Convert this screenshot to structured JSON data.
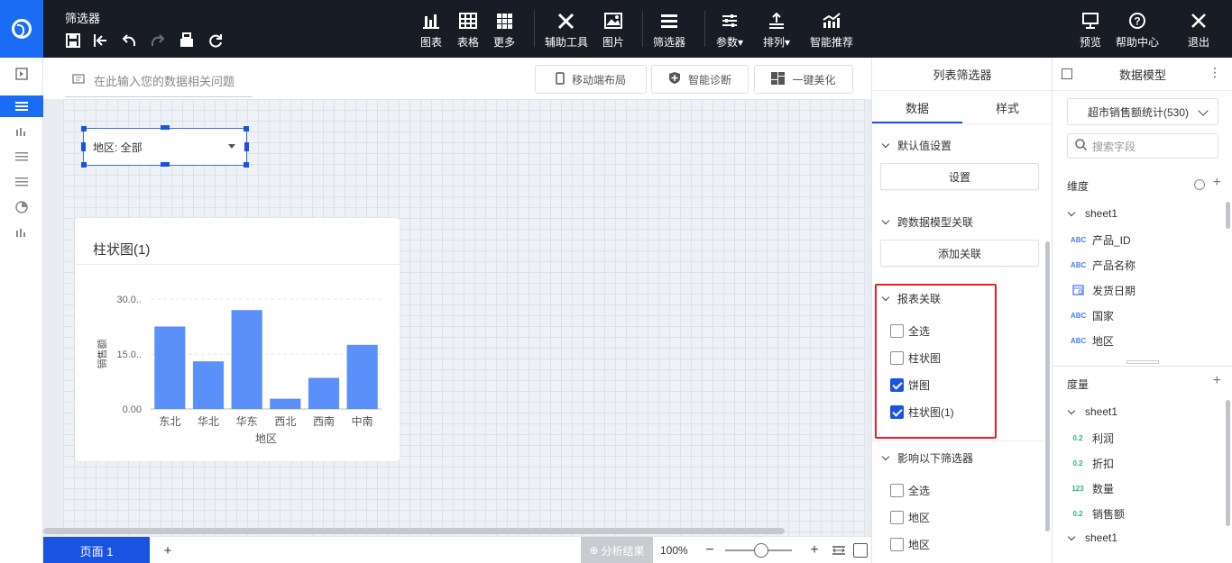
{
  "app": {
    "title": "筛选器"
  },
  "toolbar": {
    "chart": "图表",
    "table": "表格",
    "more": "更多",
    "assist": "辅助工具",
    "image": "图片",
    "filter": "筛选器",
    "param": "参数",
    "arrange": "排列",
    "smart": "智能推荐",
    "preview": "预览",
    "help": "帮助中心",
    "exit": "退出"
  },
  "canvas": {
    "question_placeholder": "在此输入您的数据相关问题",
    "mobile_layout": "移动端布局",
    "smart_diagnose": "智能诊断",
    "beautify": "一键美化",
    "filter_widget": "地区: 全部"
  },
  "chart_data": {
    "type": "bar",
    "title": "柱状图(1)",
    "categories": [
      "东北",
      "华北",
      "华东",
      "西北",
      "西南",
      "中南"
    ],
    "values": [
      22.5,
      13,
      27,
      2.8,
      8.5,
      17.5
    ],
    "xlabel": "地区",
    "ylabel": "销售额",
    "ylim": [
      0,
      30
    ],
    "y_ticks": [
      "0.00",
      "15.0..",
      "30.0.."
    ],
    "color": "#5b8ff9",
    "grid": true
  },
  "bottom": {
    "page_tab": "页面 1",
    "add": "+",
    "analyze": "分析结果",
    "zoom": "100%"
  },
  "filter_panel": {
    "title": "列表筛选器",
    "tab_data": "数据",
    "tab_style": "样式",
    "default_section": "默认值设置",
    "default_btn": "设置",
    "cross_section": "跨数据模型关联",
    "cross_btn": "添加关联",
    "report_section": "报表关联",
    "report_items": [
      {
        "label": "全选",
        "checked": false
      },
      {
        "label": "柱状图",
        "checked": false
      },
      {
        "label": "饼图",
        "checked": true
      },
      {
        "label": "柱状图(1)",
        "checked": true
      }
    ],
    "affect_section": "影响以下筛选器",
    "affect_items": [
      {
        "label": "全选",
        "checked": false
      },
      {
        "label": "地区",
        "checked": false
      },
      {
        "label": "地区",
        "checked": false
      }
    ]
  },
  "model_panel": {
    "title": "数据模型",
    "model": "超市销售额统计(530)",
    "search_placeholder": "搜索字段",
    "dim_header": "维度",
    "dim_sheet": "sheet1",
    "dims": [
      {
        "type": "ABC",
        "label": "产品_ID"
      },
      {
        "type": "ABC",
        "label": "产品名称"
      },
      {
        "type": "cal",
        "label": "发货日期"
      },
      {
        "type": "ABC",
        "label": "国家"
      },
      {
        "type": "ABC",
        "label": "地区"
      }
    ],
    "measure_header": "度量",
    "measure_sheet": "sheet1",
    "measures": [
      {
        "type": "0.2",
        "label": "利润"
      },
      {
        "type": "0.2",
        "label": "折扣"
      },
      {
        "type": "123",
        "label": "数量"
      },
      {
        "type": "0.2",
        "label": "销售额"
      }
    ],
    "measure_sheet2": "sheet1"
  }
}
